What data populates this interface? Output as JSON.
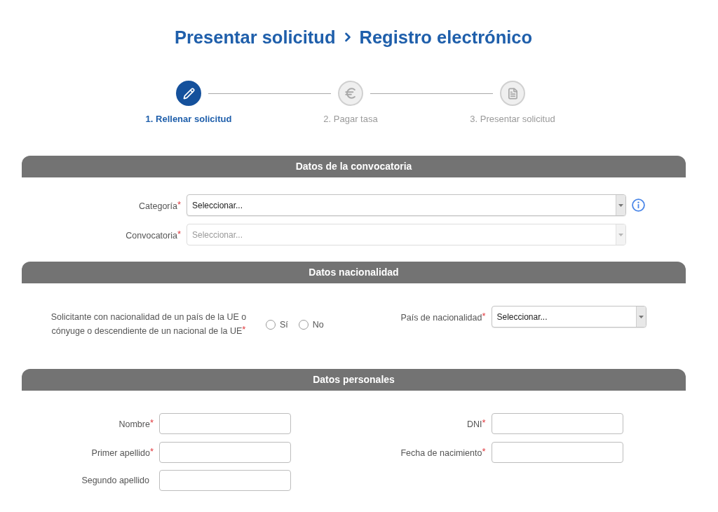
{
  "breadcrumb": [
    {
      "label": "Presentar solicitud"
    },
    {
      "label": "Registro electrónico"
    }
  ],
  "steps": [
    {
      "label": "1. Rellenar solicitud",
      "kind": "edit",
      "selected": true
    },
    {
      "label": "2. Pagar tasa",
      "kind": "payment",
      "selected": false
    },
    {
      "label": "3. Presentar solicitud",
      "kind": "document",
      "selected": false
    }
  ],
  "sections": [
    {
      "title": "Datos de la convocatoria",
      "kind": "wide",
      "fields": [
        {
          "kind": "select",
          "label": "Categoría",
          "required_mark": "*",
          "value": "Seleccionar...",
          "disabled": false,
          "info": true
        },
        {
          "kind": "select",
          "label": "Convocatoria",
          "required_mark": "*",
          "value": "Seleccionar...",
          "disabled": true
        }
      ]
    },
    {
      "title": "Datos nacionalidad",
      "kind": "columns",
      "columns": [
        {
          "fields": [
            {
              "kind": "radio",
              "label": "Solicitante con nacionalidad de un país de la UE o cónyuge o descendiente de un nacional de la UE",
              "required_mark": "*",
              "options": [
                {
                  "label": "Sí",
                  "selected": false
                },
                {
                  "label": "No",
                  "selected": false
                }
              ]
            }
          ]
        },
        {
          "fields": [
            {
              "kind": "select",
              "label": "País de nacionalidad",
              "required_mark": "*",
              "value": "Seleccionar...",
              "disabled": false
            }
          ]
        }
      ]
    },
    {
      "title": "Datos personales",
      "kind": "columns",
      "columns": [
        {
          "fields": [
            {
              "kind": "text",
              "label": "Nombre",
              "required_mark": "*"
            },
            {
              "kind": "text",
              "label": "Primer apellido",
              "required_mark": "*"
            },
            {
              "kind": "text",
              "label": "Segundo apellido"
            }
          ]
        },
        {
          "fields": [
            {
              "kind": "text",
              "label": "DNI",
              "required_mark": "*"
            },
            {
              "kind": "text",
              "label": "Fecha de nacimiento",
              "required_mark": "*"
            }
          ]
        }
      ]
    }
  ]
}
